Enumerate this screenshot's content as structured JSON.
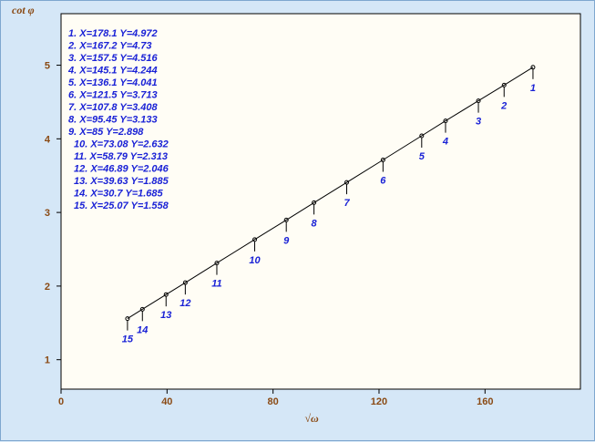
{
  "chart_data": {
    "type": "scatter",
    "title": "",
    "xlabel": "√ω",
    "ylabel": "cot φ",
    "xlim": [
      0,
      196
    ],
    "ylim": [
      0.6,
      5.7
    ],
    "x_ticks": [
      0,
      40,
      80,
      120,
      160
    ],
    "y_ticks": [
      1,
      2,
      3,
      4,
      5
    ],
    "grid": false,
    "legend_position": "top-left",
    "show_fit_line": true,
    "points": [
      {
        "label": "1",
        "x": 178.1,
        "y": 4.972,
        "text": "1. X=178.1  Y=4.972"
      },
      {
        "label": "2",
        "x": 167.2,
        "y": 4.73,
        "text": "2. X=167.2  Y=4.73"
      },
      {
        "label": "3",
        "x": 157.5,
        "y": 4.516,
        "text": "3. X=157.5  Y=4.516"
      },
      {
        "label": "4",
        "x": 145.1,
        "y": 4.244,
        "text": "4. X=145.1  Y=4.244"
      },
      {
        "label": "5",
        "x": 136.1,
        "y": 4.041,
        "text": "5. X=136.1  Y=4.041"
      },
      {
        "label": "6",
        "x": 121.5,
        "y": 3.713,
        "text": "6. X=121.5  Y=3.713"
      },
      {
        "label": "7",
        "x": 107.8,
        "y": 3.408,
        "text": "7. X=107.8  Y=3.408"
      },
      {
        "label": "8",
        "x": 95.45,
        "y": 3.133,
        "text": "8. X=95.45  Y=3.133"
      },
      {
        "label": "9",
        "x": 85,
        "y": 2.898,
        "text": "9. X=85  Y=2.898"
      },
      {
        "label": "10",
        "x": 73.08,
        "y": 2.632,
        "text": "10. X=73.08  Y=2.632"
      },
      {
        "label": "11",
        "x": 58.79,
        "y": 2.313,
        "text": "11. X=58.79  Y=2.313"
      },
      {
        "label": "12",
        "x": 46.89,
        "y": 2.046,
        "text": "12. X=46.89  Y=2.046"
      },
      {
        "label": "13",
        "x": 39.63,
        "y": 1.885,
        "text": "13. X=39.63  Y=1.885"
      },
      {
        "label": "14",
        "x": 30.7,
        "y": 1.685,
        "text": "14. X=30.7  Y=1.685"
      },
      {
        "label": "15",
        "x": 25.07,
        "y": 1.558,
        "text": "15. X=25.07  Y=1.558"
      }
    ],
    "colors": {
      "background": "#d5e7f7",
      "plot_background": "#fffdf5",
      "axis_text": "#8a4a14",
      "labels": "#1a22d6",
      "line": "#000000"
    }
  }
}
